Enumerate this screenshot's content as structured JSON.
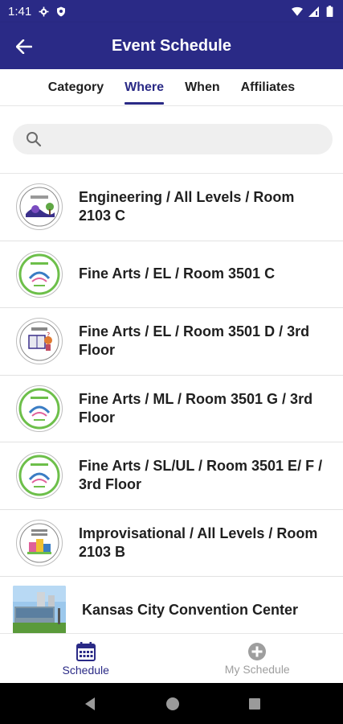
{
  "status_bar": {
    "time": "1:41"
  },
  "app_bar": {
    "title": "Event Schedule"
  },
  "tabs": [
    {
      "label": "Category",
      "active": false
    },
    {
      "label": "Where",
      "active": true
    },
    {
      "label": "When",
      "active": false
    },
    {
      "label": "Affiliates",
      "active": false
    }
  ],
  "search": {
    "value": "",
    "placeholder": ""
  },
  "locations": [
    {
      "label": "Engineering / All Levels / Room 2103 C",
      "icon": "roll-with-it-badge-icon"
    },
    {
      "label": "Fine Arts / EL / Room 3501 C",
      "icon": "flip-the-script-badge-icon"
    },
    {
      "label": "Fine Arts / EL / Room 3501 D / 3rd Floor",
      "icon": "tricky-tales-badge-icon"
    },
    {
      "label": "Fine Arts / ML / Room 3501 G / 3rd Floor",
      "icon": "flip-the-script-badge-icon"
    },
    {
      "label": "Fine Arts / SL/UL / Room 3501 E/ F / 3rd Floor",
      "icon": "flip-the-script-badge-icon"
    },
    {
      "label": "Improvisational / All Levels / Room 2103 B",
      "icon": "festival-frenzy-badge-icon"
    },
    {
      "label": "Kansas City Convention Center",
      "icon": "convention-center-photo"
    }
  ],
  "bottom_nav": [
    {
      "label": "Schedule",
      "icon": "calendar-icon",
      "active": true
    },
    {
      "label": "My Schedule",
      "icon": "add-circle-icon",
      "active": false
    }
  ],
  "colors": {
    "primary": "#2a2a86",
    "green_badge": "#6dbf4a",
    "inactive": "#9e9e9e"
  }
}
